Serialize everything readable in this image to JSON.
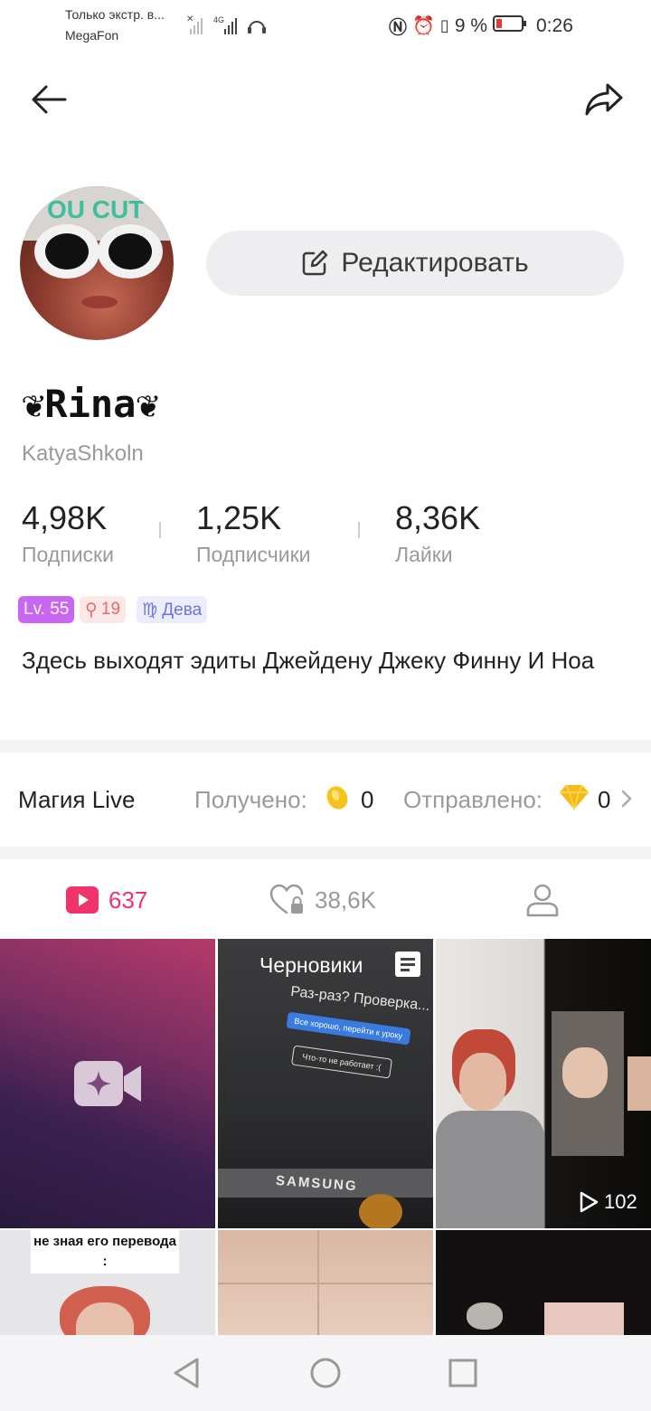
{
  "status_bar": {
    "carrier_line1": "Только экстр. в...",
    "carrier_line2": "MegaFon",
    "network": "4G",
    "battery_percent": "9 %",
    "time": "0:26"
  },
  "header": {
    "back_icon": "arrow-left-icon",
    "share_icon": "share-arrow-icon"
  },
  "profile": {
    "avatar_caption": "OU CUT",
    "edit_button_label": "Редактировать",
    "nickname": "❦Rina❦",
    "username": "KatyaShkoln",
    "stats": [
      {
        "value": "4,98K",
        "label": "Подписки"
      },
      {
        "value": "1,25K",
        "label": "Подписчики"
      },
      {
        "value": "8,36K",
        "label": "Лайки"
      }
    ],
    "badges": {
      "level": "Lv. 55",
      "age": "19",
      "zodiac": "♍ Дева"
    },
    "bio": "Здесь выходят эдиты Джейдену Джеку Финну И Ноа"
  },
  "magic_live": {
    "title": "Магия Live",
    "received_label": "Получено:",
    "received_value": "0",
    "sent_label": "Отправлено:",
    "sent_value": "0"
  },
  "tabs": [
    {
      "name": "videos",
      "count": "637",
      "color": "#f0336b"
    },
    {
      "name": "liked",
      "count": "38,6K",
      "color": "#999999"
    },
    {
      "name": "profile",
      "count": ""
    }
  ],
  "grid": {
    "drafts_label": "Черновики",
    "draft_overlay_lines": [
      "Раз-раз? Проверка...",
      "Все хорошо, перейти к уроку",
      "Что-то не работает :("
    ],
    "draft_brand": "SAMSUNG",
    "video_views": "102",
    "caption_cell": "не зная его перевода :"
  },
  "colors": {
    "accent": "#f0336b",
    "level_badge": "#c966f2",
    "age_badge_bg": "#fde8e8",
    "zodiac_badge_bg": "#ececfb"
  }
}
